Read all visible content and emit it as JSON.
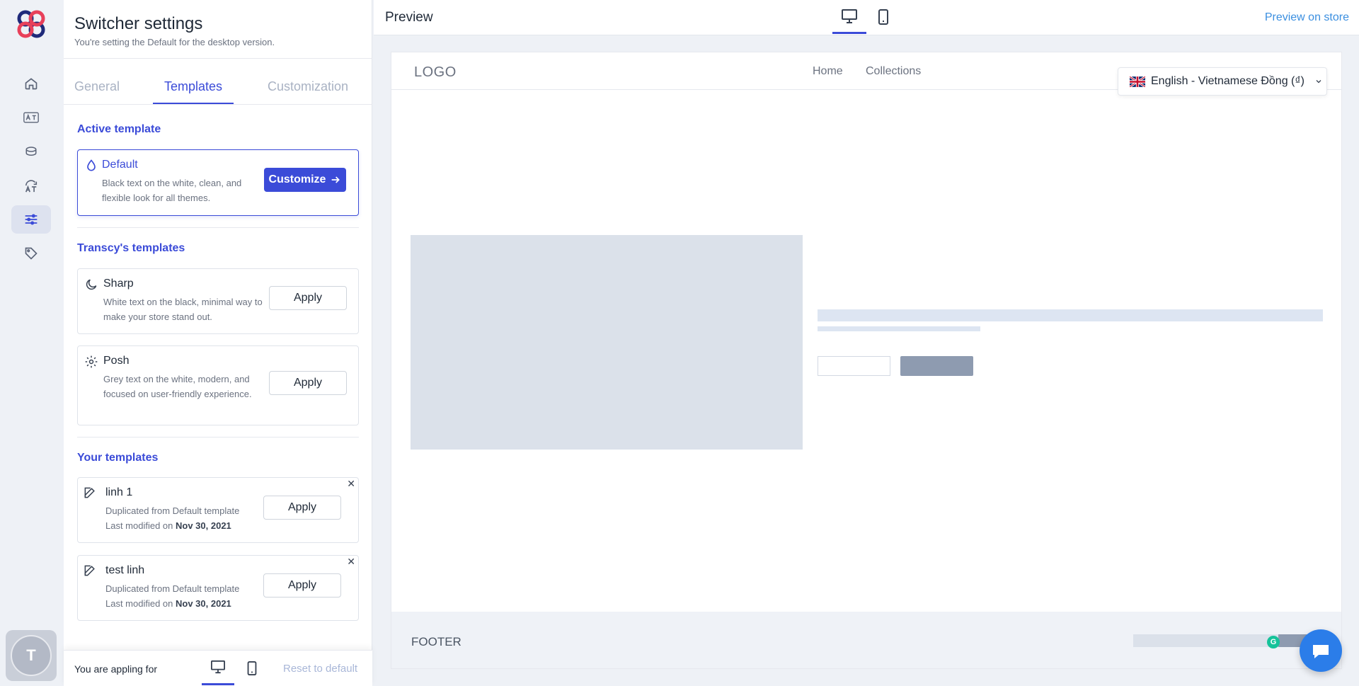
{
  "sidebar": {
    "items": [
      {
        "icon": "home-icon"
      },
      {
        "icon": "translate-icon"
      },
      {
        "icon": "database-icon"
      },
      {
        "icon": "auto-translate-icon"
      },
      {
        "icon": "sliders-icon",
        "active": true
      },
      {
        "icon": "tag-icon"
      }
    ],
    "avatar_initial": "T"
  },
  "panel": {
    "title": "Switcher settings",
    "subtitle": "You're setting the Default for the desktop version.",
    "tabs": [
      "General",
      "Templates",
      "Customization"
    ],
    "active_tab": "Templates",
    "active_template": {
      "section_title": "Active template",
      "name": "Default",
      "description": "Black text on the white, clean, and flexible look for all themes.",
      "button": "Customize"
    },
    "transcy_templates": {
      "section_title": "Transcy's templates",
      "items": [
        {
          "name": "Sharp",
          "description": "White text on the black, minimal way to make your store stand out.",
          "button": "Apply"
        },
        {
          "name": "Posh",
          "description": "Grey text on the white, modern, and focused on user-friendly experience.",
          "button": "Apply"
        }
      ]
    },
    "your_templates": {
      "section_title": "Your templates",
      "items": [
        {
          "name": "linh 1",
          "line1": "Duplicated from Default template",
          "line2_prefix": "Last modified on ",
          "date": "Nov 30, 2021",
          "button": "Apply"
        },
        {
          "name": "test linh",
          "line1": "Duplicated from Default template",
          "line2_prefix": "Last modified on ",
          "date": "Nov 30, 2021",
          "button": "Apply"
        }
      ]
    },
    "footer": {
      "label": "You are appling for",
      "reset": "Reset to default"
    }
  },
  "preview": {
    "title": "Preview",
    "store_link": "Preview on store",
    "page": {
      "logo": "LOGO",
      "menu": [
        "Home",
        "Collections"
      ],
      "switcher": "English - Vietnamese Đồng (₫)",
      "footer": "FOOTER"
    }
  },
  "colors": {
    "accent": "#3b4bd8",
    "link": "#3b8fe0",
    "placeholder": "#dbe1ea",
    "placeholder_dark": "#8e9bb0"
  }
}
